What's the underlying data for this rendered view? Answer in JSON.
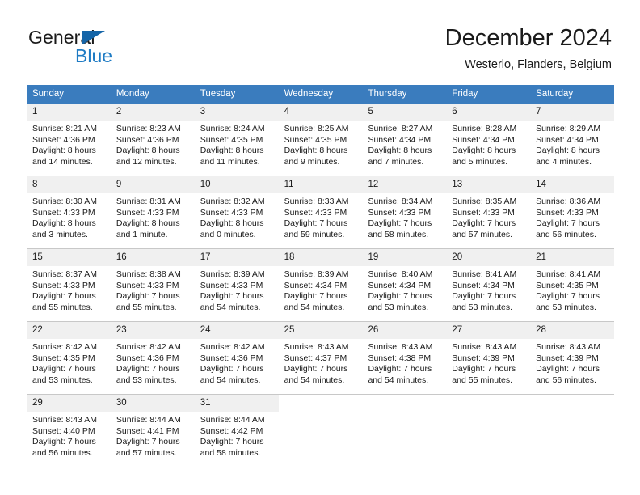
{
  "logo": {
    "word_one": "General",
    "word_two": "Blue",
    "triangle_color": "#1565a8",
    "blue_color": "#1e7bc4"
  },
  "header": {
    "title": "December 2024",
    "location": "Westerlo, Flanders, Belgium"
  },
  "colors": {
    "header_row": "#3a7cbe",
    "daynum_band": "#f0f0f0",
    "grid_line": "#c8c8c8"
  },
  "weekdays": [
    "Sunday",
    "Monday",
    "Tuesday",
    "Wednesday",
    "Thursday",
    "Friday",
    "Saturday"
  ],
  "weeks": [
    [
      {
        "day": "1",
        "sunrise": "Sunrise: 8:21 AM",
        "sunset": "Sunset: 4:36 PM",
        "daylight1": "Daylight: 8 hours",
        "daylight2": "and 14 minutes."
      },
      {
        "day": "2",
        "sunrise": "Sunrise: 8:23 AM",
        "sunset": "Sunset: 4:36 PM",
        "daylight1": "Daylight: 8 hours",
        "daylight2": "and 12 minutes."
      },
      {
        "day": "3",
        "sunrise": "Sunrise: 8:24 AM",
        "sunset": "Sunset: 4:35 PM",
        "daylight1": "Daylight: 8 hours",
        "daylight2": "and 11 minutes."
      },
      {
        "day": "4",
        "sunrise": "Sunrise: 8:25 AM",
        "sunset": "Sunset: 4:35 PM",
        "daylight1": "Daylight: 8 hours",
        "daylight2": "and 9 minutes."
      },
      {
        "day": "5",
        "sunrise": "Sunrise: 8:27 AM",
        "sunset": "Sunset: 4:34 PM",
        "daylight1": "Daylight: 8 hours",
        "daylight2": "and 7 minutes."
      },
      {
        "day": "6",
        "sunrise": "Sunrise: 8:28 AM",
        "sunset": "Sunset: 4:34 PM",
        "daylight1": "Daylight: 8 hours",
        "daylight2": "and 5 minutes."
      },
      {
        "day": "7",
        "sunrise": "Sunrise: 8:29 AM",
        "sunset": "Sunset: 4:34 PM",
        "daylight1": "Daylight: 8 hours",
        "daylight2": "and 4 minutes."
      }
    ],
    [
      {
        "day": "8",
        "sunrise": "Sunrise: 8:30 AM",
        "sunset": "Sunset: 4:33 PM",
        "daylight1": "Daylight: 8 hours",
        "daylight2": "and 3 minutes."
      },
      {
        "day": "9",
        "sunrise": "Sunrise: 8:31 AM",
        "sunset": "Sunset: 4:33 PM",
        "daylight1": "Daylight: 8 hours",
        "daylight2": "and 1 minute."
      },
      {
        "day": "10",
        "sunrise": "Sunrise: 8:32 AM",
        "sunset": "Sunset: 4:33 PM",
        "daylight1": "Daylight: 8 hours",
        "daylight2": "and 0 minutes."
      },
      {
        "day": "11",
        "sunrise": "Sunrise: 8:33 AM",
        "sunset": "Sunset: 4:33 PM",
        "daylight1": "Daylight: 7 hours",
        "daylight2": "and 59 minutes."
      },
      {
        "day": "12",
        "sunrise": "Sunrise: 8:34 AM",
        "sunset": "Sunset: 4:33 PM",
        "daylight1": "Daylight: 7 hours",
        "daylight2": "and 58 minutes."
      },
      {
        "day": "13",
        "sunrise": "Sunrise: 8:35 AM",
        "sunset": "Sunset: 4:33 PM",
        "daylight1": "Daylight: 7 hours",
        "daylight2": "and 57 minutes."
      },
      {
        "day": "14",
        "sunrise": "Sunrise: 8:36 AM",
        "sunset": "Sunset: 4:33 PM",
        "daylight1": "Daylight: 7 hours",
        "daylight2": "and 56 minutes."
      }
    ],
    [
      {
        "day": "15",
        "sunrise": "Sunrise: 8:37 AM",
        "sunset": "Sunset: 4:33 PM",
        "daylight1": "Daylight: 7 hours",
        "daylight2": "and 55 minutes."
      },
      {
        "day": "16",
        "sunrise": "Sunrise: 8:38 AM",
        "sunset": "Sunset: 4:33 PM",
        "daylight1": "Daylight: 7 hours",
        "daylight2": "and 55 minutes."
      },
      {
        "day": "17",
        "sunrise": "Sunrise: 8:39 AM",
        "sunset": "Sunset: 4:33 PM",
        "daylight1": "Daylight: 7 hours",
        "daylight2": "and 54 minutes."
      },
      {
        "day": "18",
        "sunrise": "Sunrise: 8:39 AM",
        "sunset": "Sunset: 4:34 PM",
        "daylight1": "Daylight: 7 hours",
        "daylight2": "and 54 minutes."
      },
      {
        "day": "19",
        "sunrise": "Sunrise: 8:40 AM",
        "sunset": "Sunset: 4:34 PM",
        "daylight1": "Daylight: 7 hours",
        "daylight2": "and 53 minutes."
      },
      {
        "day": "20",
        "sunrise": "Sunrise: 8:41 AM",
        "sunset": "Sunset: 4:34 PM",
        "daylight1": "Daylight: 7 hours",
        "daylight2": "and 53 minutes."
      },
      {
        "day": "21",
        "sunrise": "Sunrise: 8:41 AM",
        "sunset": "Sunset: 4:35 PM",
        "daylight1": "Daylight: 7 hours",
        "daylight2": "and 53 minutes."
      }
    ],
    [
      {
        "day": "22",
        "sunrise": "Sunrise: 8:42 AM",
        "sunset": "Sunset: 4:35 PM",
        "daylight1": "Daylight: 7 hours",
        "daylight2": "and 53 minutes."
      },
      {
        "day": "23",
        "sunrise": "Sunrise: 8:42 AM",
        "sunset": "Sunset: 4:36 PM",
        "daylight1": "Daylight: 7 hours",
        "daylight2": "and 53 minutes."
      },
      {
        "day": "24",
        "sunrise": "Sunrise: 8:42 AM",
        "sunset": "Sunset: 4:36 PM",
        "daylight1": "Daylight: 7 hours",
        "daylight2": "and 54 minutes."
      },
      {
        "day": "25",
        "sunrise": "Sunrise: 8:43 AM",
        "sunset": "Sunset: 4:37 PM",
        "daylight1": "Daylight: 7 hours",
        "daylight2": "and 54 minutes."
      },
      {
        "day": "26",
        "sunrise": "Sunrise: 8:43 AM",
        "sunset": "Sunset: 4:38 PM",
        "daylight1": "Daylight: 7 hours",
        "daylight2": "and 54 minutes."
      },
      {
        "day": "27",
        "sunrise": "Sunrise: 8:43 AM",
        "sunset": "Sunset: 4:39 PM",
        "daylight1": "Daylight: 7 hours",
        "daylight2": "and 55 minutes."
      },
      {
        "day": "28",
        "sunrise": "Sunrise: 8:43 AM",
        "sunset": "Sunset: 4:39 PM",
        "daylight1": "Daylight: 7 hours",
        "daylight2": "and 56 minutes."
      }
    ],
    [
      {
        "day": "29",
        "sunrise": "Sunrise: 8:43 AM",
        "sunset": "Sunset: 4:40 PM",
        "daylight1": "Daylight: 7 hours",
        "daylight2": "and 56 minutes."
      },
      {
        "day": "30",
        "sunrise": "Sunrise: 8:44 AM",
        "sunset": "Sunset: 4:41 PM",
        "daylight1": "Daylight: 7 hours",
        "daylight2": "and 57 minutes."
      },
      {
        "day": "31",
        "sunrise": "Sunrise: 8:44 AM",
        "sunset": "Sunset: 4:42 PM",
        "daylight1": "Daylight: 7 hours",
        "daylight2": "and 58 minutes."
      },
      {
        "day": "",
        "sunrise": "",
        "sunset": "",
        "daylight1": "",
        "daylight2": ""
      },
      {
        "day": "",
        "sunrise": "",
        "sunset": "",
        "daylight1": "",
        "daylight2": ""
      },
      {
        "day": "",
        "sunrise": "",
        "sunset": "",
        "daylight1": "",
        "daylight2": ""
      },
      {
        "day": "",
        "sunrise": "",
        "sunset": "",
        "daylight1": "",
        "daylight2": ""
      }
    ]
  ]
}
